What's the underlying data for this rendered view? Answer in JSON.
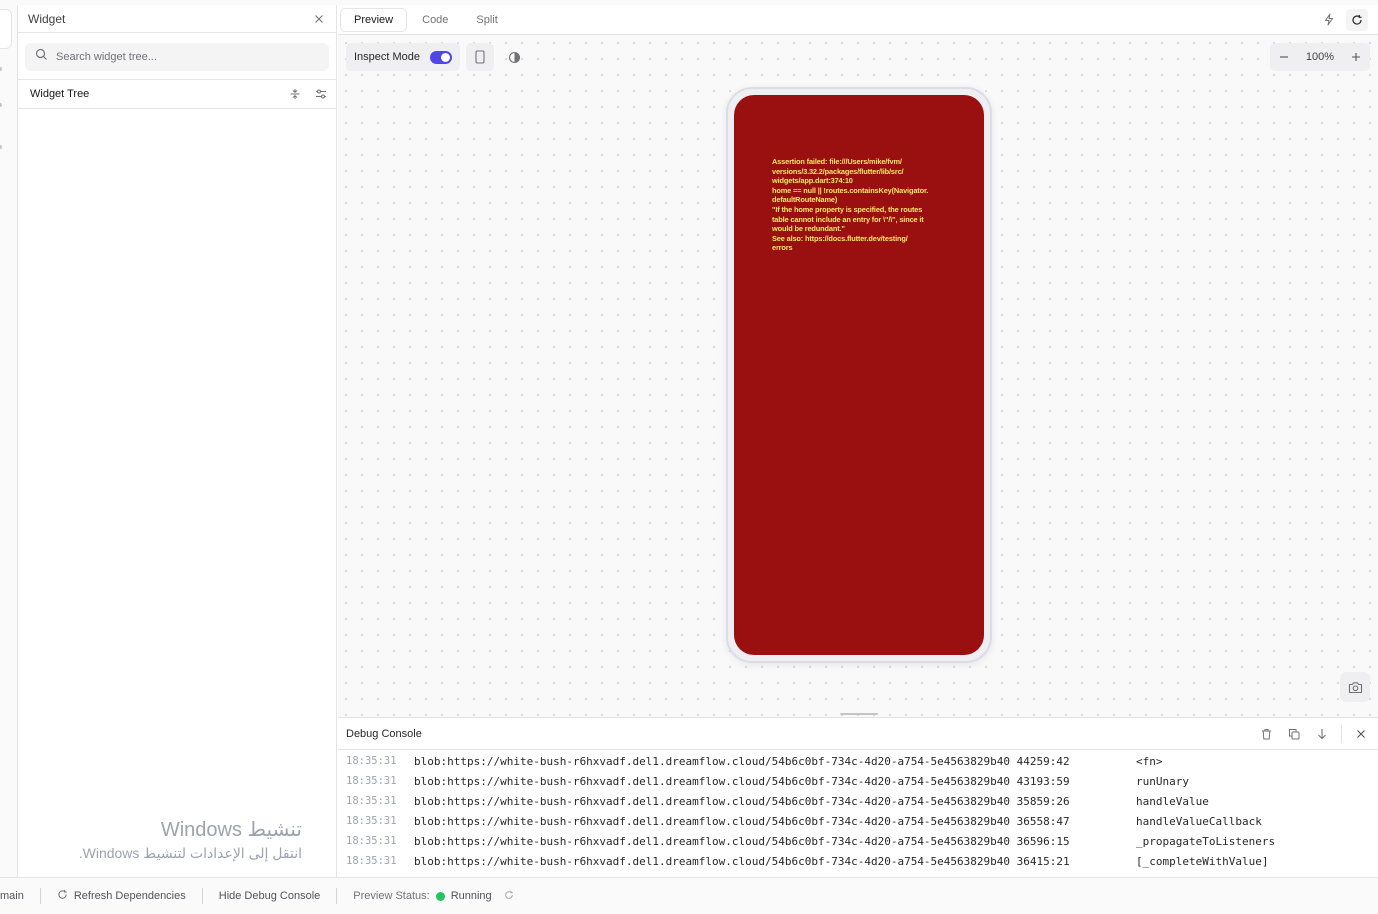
{
  "widget_panel": {
    "title": "Widget",
    "search_placeholder": "Search widget tree...",
    "tree_title": "Widget Tree"
  },
  "main": {
    "tabs": [
      {
        "label": "Preview",
        "active": true
      },
      {
        "label": "Code",
        "active": false
      },
      {
        "label": "Split",
        "active": false
      }
    ],
    "inspect_label": "Inspect Mode",
    "inspect_on": true,
    "zoom": "100%",
    "error_message": "Assertion failed: file:///Users/mike/fvm/\nversions/3.32.2/packages/flutter/lib/src/\nwidgets/app.dart:374:10\nhome == null || !routes.containsKey(Navigator.\ndefaultRouteName)\n\"If the home property is specified, the routes\ntable cannot include an entry for \\\"/\\\", since it\nwould be redundant.\"\nSee also: https://docs.flutter.dev/testing/\nerrors"
  },
  "console": {
    "title": "Debug Console",
    "logs": [
      {
        "time": "18:35:31",
        "url": "blob:https://white-bush-r6hxvadf.del1.dreamflow.cloud/54b6c0bf-734c-4d20-a754-5e4563829b40 44259:42",
        "fn": "<fn>"
      },
      {
        "time": "18:35:31",
        "url": "blob:https://white-bush-r6hxvadf.del1.dreamflow.cloud/54b6c0bf-734c-4d20-a754-5e4563829b40 43193:59",
        "fn": "runUnary"
      },
      {
        "time": "18:35:31",
        "url": "blob:https://white-bush-r6hxvadf.del1.dreamflow.cloud/54b6c0bf-734c-4d20-a754-5e4563829b40 35859:26",
        "fn": "handleValue"
      },
      {
        "time": "18:35:31",
        "url": "blob:https://white-bush-r6hxvadf.del1.dreamflow.cloud/54b6c0bf-734c-4d20-a754-5e4563829b40 36558:47",
        "fn": "handleValueCallback"
      },
      {
        "time": "18:35:31",
        "url": "blob:https://white-bush-r6hxvadf.del1.dreamflow.cloud/54b6c0bf-734c-4d20-a754-5e4563829b40 36596:15",
        "fn": "_propagateToListeners"
      },
      {
        "time": "18:35:31",
        "url": "blob:https://white-bush-r6hxvadf.del1.dreamflow.cloud/54b6c0bf-734c-4d20-a754-5e4563829b40 36415:21",
        "fn": "[_completeWithValue]"
      }
    ]
  },
  "statusbar": {
    "branch": "main",
    "refresh_label": "Refresh Dependencies",
    "hide_console_label": "Hide Debug Console",
    "preview_status_label": "Preview Status:",
    "preview_status_value": "Running",
    "status_color": "#22c55e"
  },
  "watermark": {
    "title": "تنشيط Windows",
    "subtitle": "انتقل إلى الإعدادات لتنشيط Windows."
  },
  "colors": {
    "accent": "#4f46e5",
    "error_bg": "#9a1010",
    "error_text": "#f5e66a"
  }
}
